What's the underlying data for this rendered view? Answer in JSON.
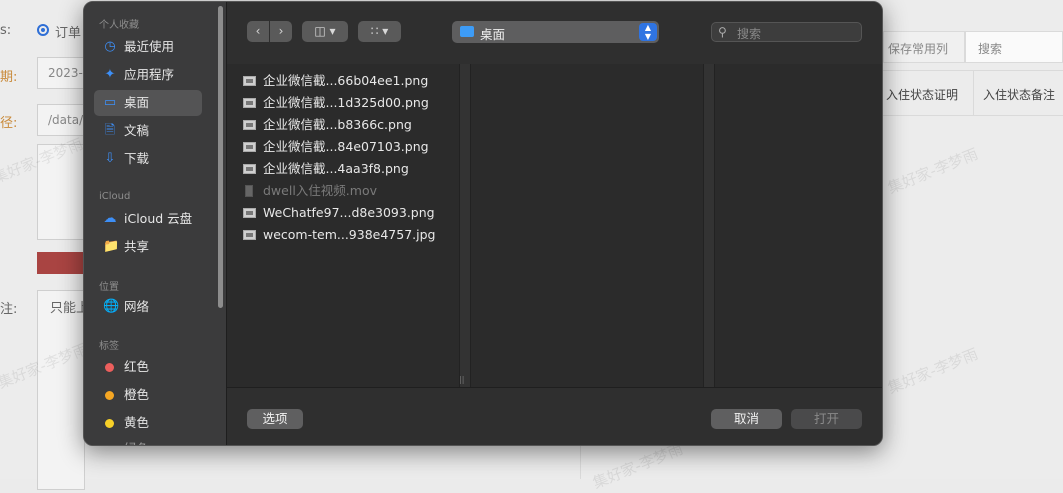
{
  "background": {
    "radio_label": "订单",
    "labels": [
      "s:",
      "期:",
      "径:",
      "注:"
    ],
    "date_value": "2023-",
    "path_value": "/data/",
    "textarea_value": "只能上",
    "save_columns_tab": "保存常用列",
    "search_tab": "搜索",
    "table_headers": [
      "入住状态证明",
      "入住状态备注"
    ],
    "watermark": "集好家-李梦雨"
  },
  "dialog": {
    "sidebar": {
      "sections": [
        {
          "heading": "个人收藏",
          "items": [
            {
              "label": "最近使用",
              "icon": "clock-icon"
            },
            {
              "label": "应用程序",
              "icon": "apps-icon"
            },
            {
              "label": "桌面",
              "icon": "desktop-icon",
              "selected": true
            },
            {
              "label": "文稿",
              "icon": "document-icon"
            },
            {
              "label": "下载",
              "icon": "download-icon"
            }
          ]
        },
        {
          "heading": "iCloud",
          "items": [
            {
              "label": "iCloud 云盘",
              "icon": "cloud-icon"
            },
            {
              "label": "共享",
              "icon": "shared-folder-icon"
            }
          ]
        },
        {
          "heading": "位置",
          "items": [
            {
              "label": "网络",
              "icon": "network-globe-icon"
            }
          ]
        },
        {
          "heading": "标签",
          "items": [
            {
              "label": "红色",
              "color": "#ec5f5d"
            },
            {
              "label": "橙色",
              "color": "#f5a623"
            },
            {
              "label": "黄色",
              "color": "#f7d028"
            },
            {
              "label": "绿色",
              "color": "#4cc552"
            }
          ]
        }
      ]
    },
    "toolbar": {
      "location": "桌面",
      "search_placeholder": "搜索"
    },
    "files": [
      {
        "name": "企业微信截...66b04ee1.png",
        "enabled": true
      },
      {
        "name": "企业微信截...1d325d00.png",
        "enabled": true
      },
      {
        "name": "企业微信截...b8366c.png",
        "enabled": true
      },
      {
        "name": "企业微信截...84e07103.png",
        "enabled": true
      },
      {
        "name": "企业微信截...4aa3f8.png",
        "enabled": true
      },
      {
        "name": "dwell入住视频.mov",
        "enabled": false
      },
      {
        "name": "WeChatfe97...d8e3093.png",
        "enabled": true
      },
      {
        "name": "wecom-tem...938e4757.jpg",
        "enabled": true
      }
    ],
    "buttons": {
      "options": "选项",
      "cancel": "取消",
      "open": "打开"
    }
  }
}
